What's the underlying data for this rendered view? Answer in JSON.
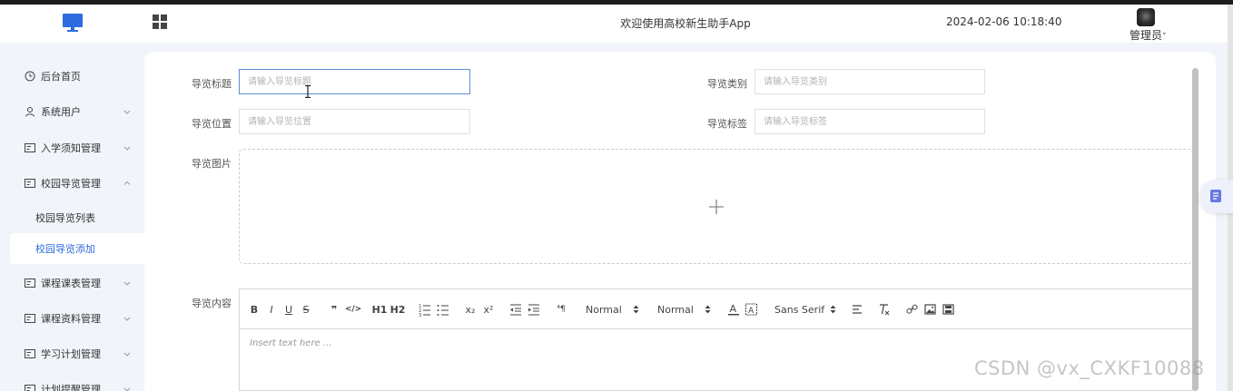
{
  "header": {
    "welcome": "欢迎使用高校新生助手App",
    "datetime": "2024-02-06 10:18:40",
    "user": "管理员",
    "caret": "˅"
  },
  "sidebar": {
    "items": [
      {
        "label": "后台首页",
        "icon": "clock-icon"
      },
      {
        "label": "系统用户",
        "icon": "user-icon"
      },
      {
        "label": "入学须知管理",
        "icon": "card-icon"
      },
      {
        "label": "校园导览管理",
        "icon": "card-icon",
        "expanded": true
      },
      {
        "label": "课程课表管理",
        "icon": "card-icon"
      },
      {
        "label": "课程资料管理",
        "icon": "card-icon"
      },
      {
        "label": "学习计划管理",
        "icon": "card-icon"
      },
      {
        "label": "计划提醒管理",
        "icon": "card-icon"
      }
    ],
    "subitems": [
      {
        "label": "校园导览列表"
      },
      {
        "label": "校园导览添加",
        "active": true
      }
    ]
  },
  "form": {
    "title_label": "导览标题",
    "title_placeholder": "请输入导览标题",
    "category_label": "导览类别",
    "category_placeholder": "请输入导览类别",
    "location_label": "导览位置",
    "location_placeholder": "请输入导览位置",
    "tags_label": "导览标签",
    "tags_placeholder": "请输入导览标签",
    "image_label": "导览图片",
    "content_label": "导览内容"
  },
  "editor": {
    "bold": "B",
    "italic": "I",
    "underline": "U",
    "strike": "S",
    "quote": "❞",
    "code": "</>",
    "h1": "H1",
    "h2": "H2",
    "sub": "x₂",
    "sup": "x²",
    "rtl": "⁴¶",
    "size_value": "Normal",
    "header_value": "Normal",
    "font_value": "Sans Serif",
    "placeholder": "Insert text here ..."
  },
  "watermark": "CSDN @vx_CXKF10088",
  "colors": {
    "accent": "#2f6bde",
    "sidebar_bg": "#f1f4fa",
    "focus_border": "#5b8fd4"
  }
}
